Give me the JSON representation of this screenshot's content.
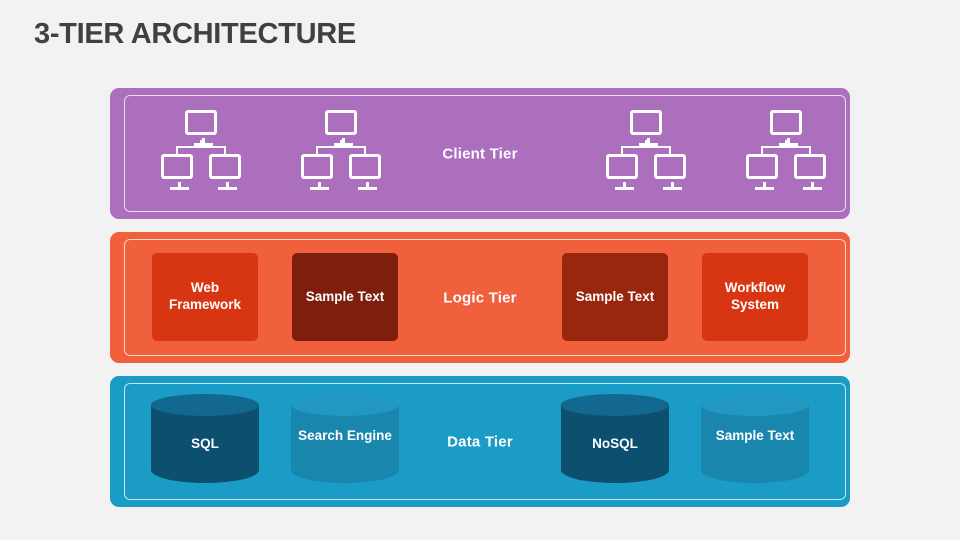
{
  "slide": {
    "title": "3-Tier Architecture",
    "background": "#f2f2f2",
    "title_color": "#404040"
  },
  "tiers": [
    {
      "id": "client",
      "label": "Client Tier",
      "band_color": "#ab6fbe",
      "icons": [
        {
          "name": "computer-network-icon-1"
        },
        {
          "name": "computer-network-icon-2"
        },
        {
          "name": "computer-network-icon-3"
        },
        {
          "name": "computer-network-icon-4"
        }
      ]
    },
    {
      "id": "logic",
      "label": "Logic Tier",
      "band_color": "#f1603c",
      "nodes": [
        {
          "label": "Web Framework",
          "color": "#d83613"
        },
        {
          "label": "Sample Text",
          "color": "#7d1f0c"
        },
        {
          "label": "Sample Text",
          "color": "#99270d"
        },
        {
          "label": "Workflow System",
          "color": "#d83613"
        }
      ]
    },
    {
      "id": "data",
      "label": "Data Tier",
      "band_color": "#1a9cc6",
      "nodes": [
        {
          "label": "SQL",
          "body_color": "#0c4f6e",
          "top_color": "#12688f"
        },
        {
          "label": "Search Engine",
          "body_color": "#1886ad",
          "top_color": "#2197c1"
        },
        {
          "label": "NoSQL",
          "body_color": "#0c4f6e",
          "top_color": "#12688f"
        },
        {
          "label": "Sample Text",
          "body_color": "#1886ad",
          "top_color": "#2197c1"
        }
      ]
    }
  ]
}
